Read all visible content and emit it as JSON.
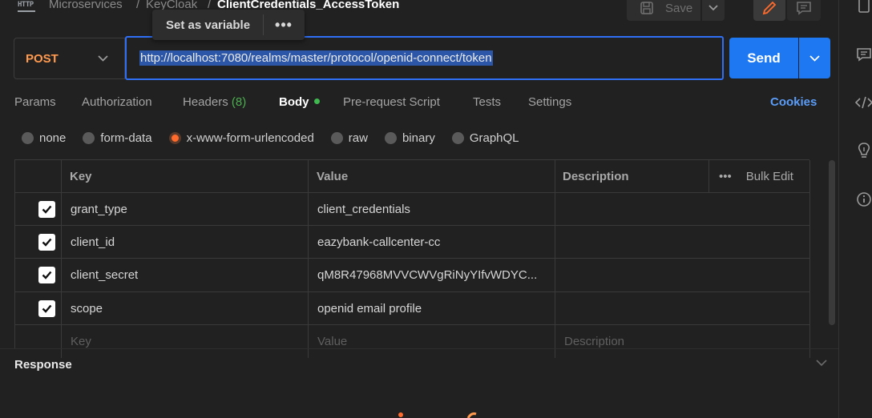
{
  "header": {
    "breadcrumb": [
      "Microservices",
      "KeyCloak"
    ],
    "separator": "/",
    "title": "ClientCredentials_AccessToken",
    "save_label": "Save",
    "http_icon_label": "HTTP"
  },
  "tooltip": {
    "label": "Set as variable",
    "more": "•••"
  },
  "request": {
    "method": "POST",
    "url": "http://localhost:7080/realms/master/protocol/openid-connect/token",
    "send_label": "Send"
  },
  "tabs": [
    {
      "label": "Params"
    },
    {
      "label": "Authorization"
    },
    {
      "label": "Headers",
      "count": "(8)"
    },
    {
      "label": "Body",
      "active": true
    },
    {
      "label": "Pre-request Script"
    },
    {
      "label": "Tests"
    },
    {
      "label": "Settings"
    }
  ],
  "cookies_label": "Cookies",
  "body_types": [
    {
      "label": "none"
    },
    {
      "label": "form-data"
    },
    {
      "label": "x-www-form-urlencoded",
      "selected": true
    },
    {
      "label": "raw"
    },
    {
      "label": "binary"
    },
    {
      "label": "GraphQL"
    }
  ],
  "table": {
    "headers": {
      "key": "Key",
      "value": "Value",
      "description": "Description",
      "bulk_edit": "Bulk Edit",
      "more": "•••"
    },
    "rows": [
      {
        "key": "grant_type",
        "value": "client_credentials",
        "checked": true
      },
      {
        "key": "client_id",
        "value": "eazybank-callcenter-cc",
        "checked": true
      },
      {
        "key": "client_secret",
        "value": "qM8R47968MVVCWVgRiNyYIfvWDYC...",
        "checked": true
      },
      {
        "key": "scope",
        "value": "openid email profile",
        "checked": true
      }
    ],
    "placeholder": {
      "key": "Key",
      "value": "Value",
      "description": "Description"
    }
  },
  "response": {
    "title": "Response"
  },
  "colors": {
    "accent": "#1d78f2",
    "method": "#ff9a4f",
    "active_dot": "#3fb950",
    "radio_selected": "#ff6b2c",
    "cookies": "#5a9cf8"
  },
  "sidebar_icons": [
    "document-icon",
    "comment-icon",
    "code-icon",
    "lightbulb-icon",
    "info-icon"
  ]
}
